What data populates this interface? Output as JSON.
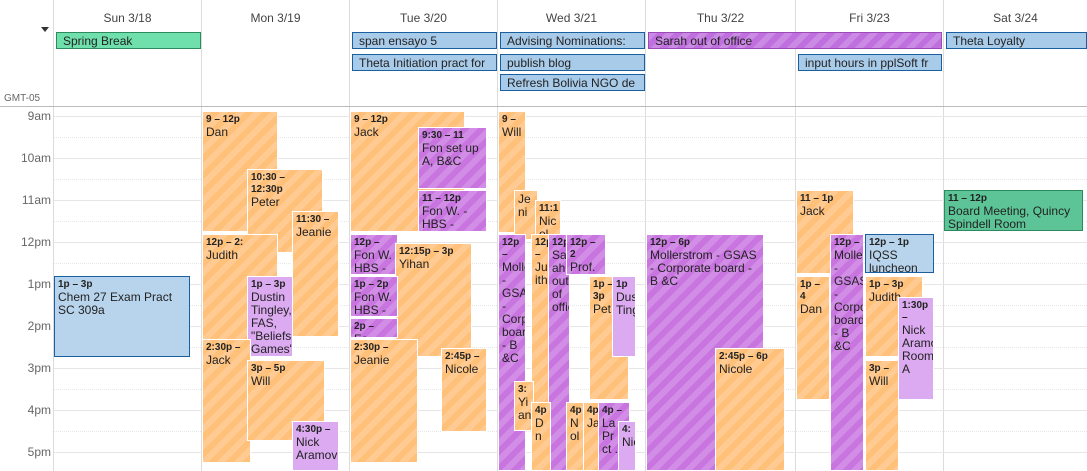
{
  "calendar": {
    "timezone": "GMT-05",
    "days": [
      "Sun 3/18",
      "Mon 3/19",
      "Tue 3/20",
      "Wed 3/21",
      "Thu 3/22",
      "Fri 3/23",
      "Sat 3/24"
    ],
    "hours": [
      "9am",
      "10am",
      "11am",
      "12pm",
      "1pm",
      "2pm",
      "3pm",
      "4pm",
      "5pm"
    ],
    "allday": [
      {
        "title": "Spring Break"
      },
      {
        "title": "span ensayo 5"
      },
      {
        "title": "Theta Initiation pract for"
      },
      {
        "title": "Advising Nominations:"
      },
      {
        "title": "publish blog"
      },
      {
        "title": "Refresh Bolivia NGO de"
      },
      {
        "title": "Sarah out of office"
      },
      {
        "title": "input hours in pplSoft fr"
      },
      {
        "title": "Theta Loyalty"
      }
    ],
    "events": [
      {
        "time": "1p – 3p",
        "title": "Chem 27 Exam Pract SC 309a"
      },
      {
        "time": "9 – 12p",
        "title": "Dan"
      },
      {
        "time": "10:30 – 12:30p",
        "title": "Peter"
      },
      {
        "time": "11:30 –",
        "title": "Jeanie"
      },
      {
        "time": "12p – 2:",
        "title": "Judith"
      },
      {
        "time": "1p – 3p",
        "title": "Dustin Tingley, FAS, \"Beliefs Games\","
      },
      {
        "time": "2:30p –",
        "title": "Jack"
      },
      {
        "time": "3p – 5p",
        "title": "Will"
      },
      {
        "time": "4:30p –",
        "title": "Nick Aramovich"
      },
      {
        "time": "9 – 12p",
        "title": "Jack"
      },
      {
        "time": "9:30 – 11",
        "title": "Fon set up A, B&C"
      },
      {
        "time": "11 – 12p",
        "title": "Fon W. - HBS -"
      },
      {
        "time": "12p –",
        "title": "Fon W. HBS -"
      },
      {
        "time": "12:15p – 3p",
        "title": "Yihan"
      },
      {
        "time": "1p – 2p",
        "title": "Fon W. HBS -"
      },
      {
        "time": "2p –",
        "title": "Fo"
      },
      {
        "time": "2:30p –",
        "title": "Jeanie"
      },
      {
        "time": "2:45p –",
        "title": "Nicole"
      },
      {
        "time": "9 –",
        "title": "Will"
      },
      {
        "time": "",
        "title": "Je ni"
      },
      {
        "time": "11:1",
        "title": "Nic ol"
      },
      {
        "time": "12p –",
        "title": "Mollerstrom - GSAS - Corporate board - B &C"
      },
      {
        "time": "12p –",
        "title": "Ju ith"
      },
      {
        "time": "12p",
        "title": "Sa ah out of office"
      },
      {
        "time": "12p – 2",
        "title": "Prof. Todd Ro"
      },
      {
        "time": "1p – 3p",
        "title": "Pet"
      },
      {
        "time": "1p",
        "title": "Dustin Ting"
      },
      {
        "time": "3:",
        "title": "Yi an"
      },
      {
        "time": "4p",
        "title": "D n"
      },
      {
        "time": "4p",
        "title": "N ol"
      },
      {
        "time": "4p",
        "title": "Ja"
      },
      {
        "time": "4p –",
        "title": "La Pr ct ..."
      },
      {
        "time": "4:",
        "title": "Nick"
      },
      {
        "time": "12p – 6p",
        "title": "Mollerstrom - GSAS - Corporate board - B &C"
      },
      {
        "time": "2:45p – 6p",
        "title": "Nicole"
      },
      {
        "time": "11 – 1p",
        "title": "Jack"
      },
      {
        "time": "1p – 4",
        "title": "Dan"
      },
      {
        "time": "12p –",
        "title": "Mollerstrom - GSAS - Corporate board - B &C"
      },
      {
        "time": "12p – 1p",
        "title": "IQSS luncheon"
      },
      {
        "time": "1p – 3p",
        "title": "Judith"
      },
      {
        "time": "3p –",
        "title": "Will"
      },
      {
        "time": "1:30p –",
        "title": "Nick Aramovich Room A"
      },
      {
        "time": "11 – 12p",
        "title": "Board Meeting, Quincy Spindell Room"
      }
    ]
  }
}
